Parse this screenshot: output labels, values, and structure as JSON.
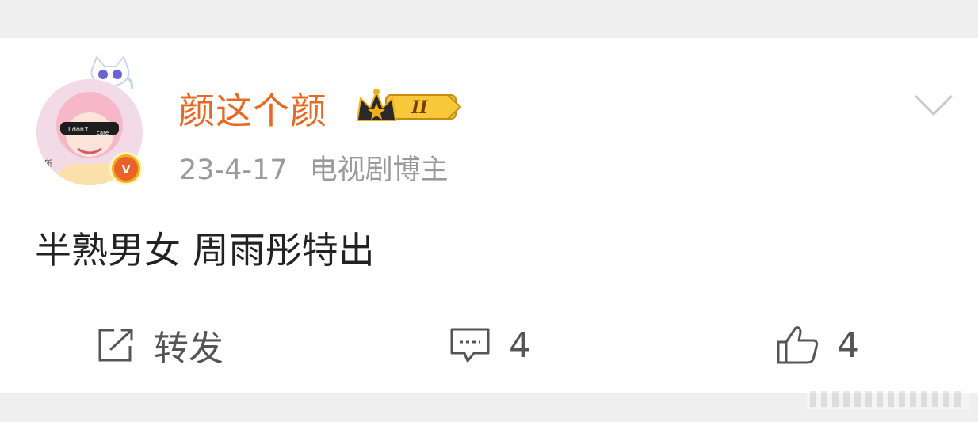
{
  "post": {
    "username": "颜这个颜",
    "level_badge_text": "II",
    "date": "23-4-17",
    "role": "电视剧博主",
    "content": "半熟男女 周雨彤特出",
    "avatar_text": {
      "left": "无所",
      "glasses": "I don't care",
      "right": "谓"
    }
  },
  "actions": {
    "forward_label": "转发",
    "comment_count": "4",
    "like_count": "4"
  },
  "colors": {
    "username": "#e86a22",
    "meta": "#9a9a9a",
    "background": "#efefef",
    "badge_orange": "#e8622a",
    "crown_gold": "#f2b018"
  },
  "icons": [
    "verified-v-icon",
    "crown-level-icon",
    "chevron-down-icon",
    "forward-icon",
    "comment-icon",
    "like-icon"
  ]
}
